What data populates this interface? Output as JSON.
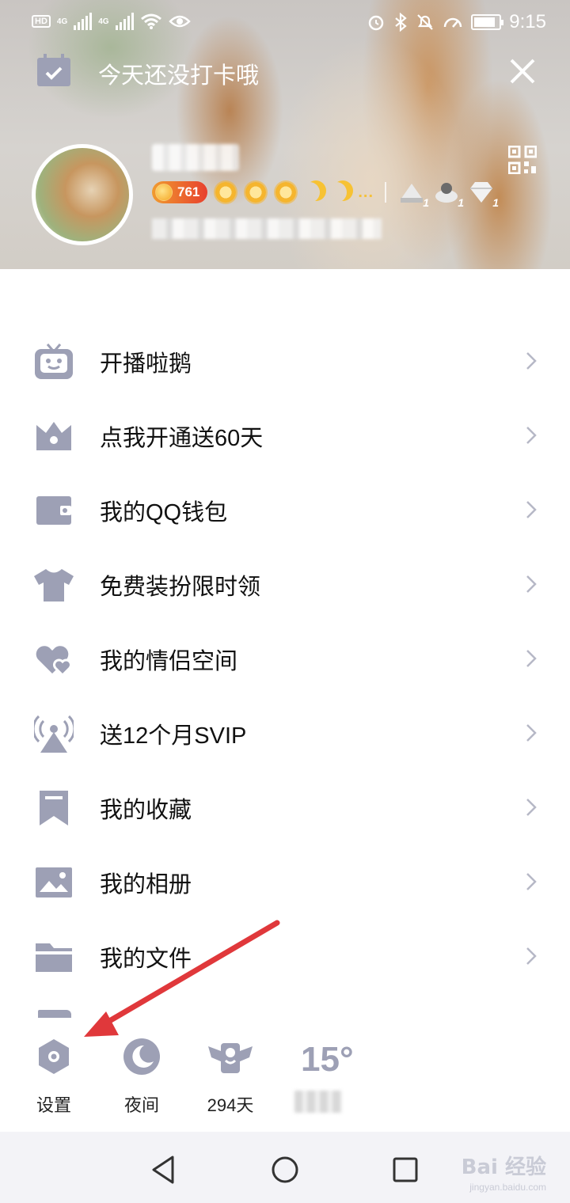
{
  "status_bar": {
    "left_labels": [
      "HD",
      "4G",
      "4G"
    ],
    "time": "9:15"
  },
  "header": {
    "checkin_text": "今天还没打卡哦",
    "level_number": "761",
    "medal_counts": [
      "1",
      "1",
      "1"
    ],
    "ellipsis": "..."
  },
  "menu": {
    "items": [
      {
        "label": "开播啦鹅",
        "icon": "tv-robot-icon"
      },
      {
        "label": "点我开通送60天",
        "icon": "crown-icon"
      },
      {
        "label": "我的QQ钱包",
        "icon": "wallet-icon"
      },
      {
        "label": "免费装扮限时领",
        "icon": "tshirt-icon"
      },
      {
        "label": "我的情侣空间",
        "icon": "hearts-icon"
      },
      {
        "label": "送12个月SVIP",
        "icon": "broadcast-icon"
      },
      {
        "label": "我的收藏",
        "icon": "bookmark-icon"
      },
      {
        "label": "我的相册",
        "icon": "photo-icon"
      },
      {
        "label": "我的文件",
        "icon": "folder-icon"
      }
    ]
  },
  "quick_bar": {
    "settings_label": "设置",
    "night_label": "夜间",
    "days_label": "294天",
    "temperature": "15°"
  },
  "watermark": {
    "brand": "Bai 经验",
    "url": "jingyan.baidu.com"
  },
  "colors": {
    "icon_gray": "#9da0b5",
    "arrow_red": "#e0383b",
    "text_dark": "#111111"
  }
}
